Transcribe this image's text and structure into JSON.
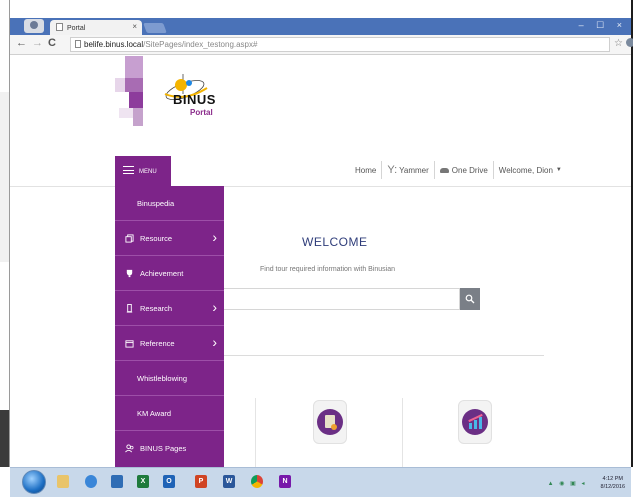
{
  "browser": {
    "tab_title": "Portal",
    "tab_close": "×",
    "address_host": "belife.binus.local",
    "address_path": "/SitePages/index_testong.aspx#",
    "window_controls": "– ☐ ×"
  },
  "brand": {
    "name": "BINUS",
    "sub": "Portal"
  },
  "menu": {
    "label": "MENU",
    "items": [
      {
        "label": "Binuspedia",
        "icon": "none",
        "has_submenu": false
      },
      {
        "label": "Resource",
        "icon": "copy-icon",
        "has_submenu": true
      },
      {
        "label": "Achievement",
        "icon": "trophy-icon",
        "has_submenu": false
      },
      {
        "label": "Research",
        "icon": "flask-icon",
        "has_submenu": true
      },
      {
        "label": "Reference",
        "icon": "calendar-icon",
        "has_submenu": true
      },
      {
        "label": "Whistleblowing",
        "icon": "none",
        "has_submenu": false
      },
      {
        "label": "KM Award",
        "icon": "none",
        "has_submenu": false
      },
      {
        "label": "BINUS Pages",
        "icon": "people-icon",
        "has_submenu": false
      }
    ]
  },
  "topnav": {
    "home": "Home",
    "yammer_mark": "Y:",
    "yammer": "Yammer",
    "onedrive": "One Drive",
    "welcome_user": "Welcome, Dion"
  },
  "main": {
    "title": "WELCOME",
    "subtitle": "Find tour required information with Binusian",
    "search_value": ""
  },
  "taskbar": {
    "apps": [
      "explorer",
      "ie",
      "people",
      "excel",
      "outlook",
      "powerpoint",
      "word",
      "chrome",
      "onenote"
    ],
    "clock_time": "4:12 PM",
    "clock_date": "8/12/2016"
  },
  "colors": {
    "brand_purple": "#7d2489",
    "title_blue": "#2f3d7a",
    "chrome_blue": "#4a72b8"
  }
}
